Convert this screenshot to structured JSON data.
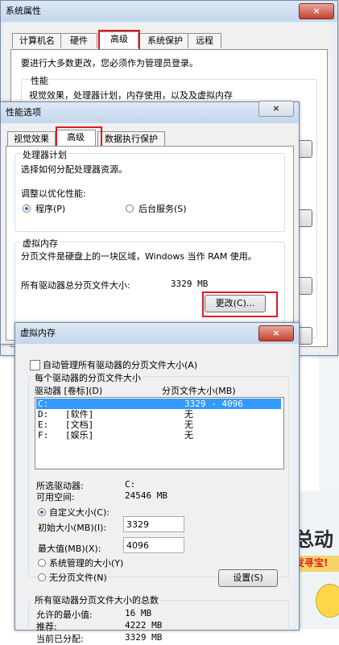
{
  "sysprops": {
    "title": "系统属性",
    "tabs": [
      "计算机名",
      "硬件",
      "高级",
      "系统保护",
      "远程"
    ],
    "admin_note": "要进行大多数更改，您必须作为管理员登录。",
    "perf_group": "性能",
    "perf_desc": "视觉效果，处理器计划，内存使用，以及及虚拟内存",
    "close_glyph": "×"
  },
  "perfopts": {
    "title": "性能选项",
    "tabs": [
      "视觉效果",
      "高级",
      "数据执行保护"
    ],
    "processor_group": "处理器计划",
    "processor_desc": "选择如何分配处理器资源。",
    "optimize_label": "调整以优化性能:",
    "opt_program": "程序(P)",
    "opt_background": "后台服务(S)",
    "vm_group": "虚拟内存",
    "vm_desc": "分页文件是硬盘上的一块区域，Windows 当作 RAM 使用。",
    "vm_total_label": "所有驱动器总分页文件大小:",
    "vm_total_value": "3329 MB",
    "change_button": "更改(C)..."
  },
  "vmem": {
    "title": "虚拟内存",
    "auto_manage": "自动管理所有驱动器的分页文件大小(A)",
    "per_drive_group": "每个驱动器的分页文件大小",
    "col_drive": "驱动器 [卷标](D)",
    "col_size": "分页文件大小(MB)",
    "drives": [
      {
        "drive": "C:",
        "label": "",
        "size": "3329 - 4096"
      },
      {
        "drive": "D:",
        "label": "[软件]",
        "size": "无"
      },
      {
        "drive": "E:",
        "label": "[文档]",
        "size": "无"
      },
      {
        "drive": "F:",
        "label": "[娱乐]",
        "size": "无"
      }
    ],
    "selected_drive_label": "所选驱动器:",
    "selected_drive_value": "C:",
    "free_space_label": "可用空间:",
    "free_space_value": "24546 MB",
    "custom_size": "自定义大小(C):",
    "initial_label": "初始大小(MB)(I):",
    "initial_value": "3329",
    "max_label": "最大值(MB)(X):",
    "max_value": "4096",
    "system_managed": "系统管理的大小(Y)",
    "no_paging": "无分页文件(N)",
    "set_button": "设置(S)",
    "total_group": "所有驱动器分页文件大小的总数",
    "min_label": "允许的最小值:",
    "min_value": "16 MB",
    "rec_label": "推荐:",
    "rec_value": "4222 MB",
    "cur_label": "当前已分配:",
    "cur_value": "3329 MB",
    "close_glyph": "×"
  },
  "background": {
    "promo_text": "总动",
    "promo_badge": "发寻宝!"
  },
  "colors": {
    "highlight": "#e01b1b",
    "selection": "#3399ff"
  }
}
